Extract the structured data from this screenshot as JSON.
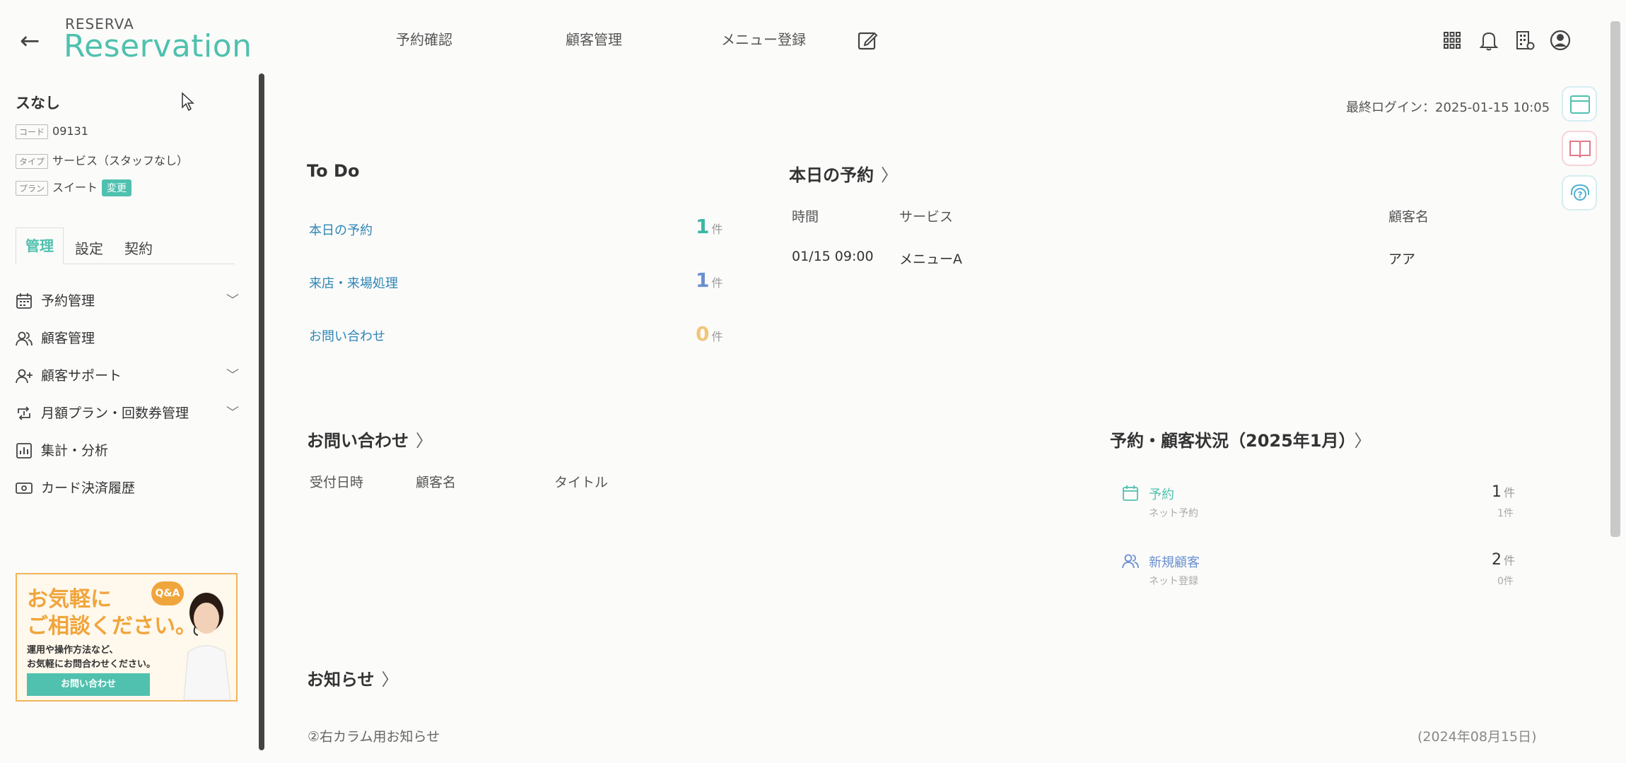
{
  "header": {
    "brand_small": "RESERVA",
    "brand_big": "Reservation",
    "nav": [
      "予約確認",
      "顧客管理",
      "メニュー登録"
    ]
  },
  "sidebar": {
    "store_name": "スなし",
    "code_tag": "コード",
    "code_value": "09131",
    "type_tag": "タイプ",
    "type_value": "サービス（スタッフなし）",
    "plan_tag": "プラン",
    "plan_value": "スイート",
    "change_label": "変更",
    "tabs": [
      "管理",
      "設定",
      "契約"
    ],
    "menu": [
      {
        "label": "予約管理",
        "icon": "calendar-icon",
        "expand": true
      },
      {
        "label": "顧客管理",
        "icon": "users-icon",
        "expand": false
      },
      {
        "label": "顧客サポート",
        "icon": "user-plus-icon",
        "expand": true
      },
      {
        "label": "月額プラン・回数券管理",
        "icon": "repeat-icon",
        "expand": true
      },
      {
        "label": "集計・分析",
        "icon": "chart-icon",
        "expand": false
      },
      {
        "label": "カード決済履歴",
        "icon": "card-icon",
        "expand": false
      }
    ],
    "banner": {
      "line1": "お気軽に",
      "line2": "ご相談ください。",
      "badge": "Q&A",
      "desc1": "運用や操作方法など、",
      "desc2": "お気軽にお問合わせください。",
      "button": "お問い合わせ"
    }
  },
  "main": {
    "last_login": "最終ログイン：2025-01-15 10:05",
    "todo": {
      "title": "To Do",
      "items": [
        {
          "label": "本日の予約",
          "count": "1",
          "color": "#3bb8a4"
        },
        {
          "label": "来店・来場処理",
          "count": "1",
          "color": "#6a8fd0"
        },
        {
          "label": "お問い合わせ",
          "count": "0",
          "color": "#f2c57a"
        }
      ],
      "unit": "件"
    },
    "today": {
      "title": "本日の予約",
      "cols": [
        "時間",
        "サービス",
        "顧客名"
      ],
      "rows": [
        [
          "01/15 09:00",
          "メニューA",
          "アア"
        ]
      ]
    },
    "inquiry": {
      "title": "お問い合わせ",
      "cols": [
        "受付日時",
        "顧客名",
        "タイトル"
      ]
    },
    "status": {
      "title": "予約・顧客状況（2025年1月）",
      "items": [
        {
          "label": "予約",
          "sub": "ネット予約",
          "count": "1",
          "sub_count": "1",
          "unit": "件"
        },
        {
          "label": "新規顧客",
          "sub": "ネット登録",
          "count": "2",
          "sub_count": "0",
          "unit": "件"
        }
      ]
    },
    "news": {
      "title": "お知らせ",
      "item": "②右カラム用お知らせ",
      "date": "(2024年08月15日)"
    }
  }
}
